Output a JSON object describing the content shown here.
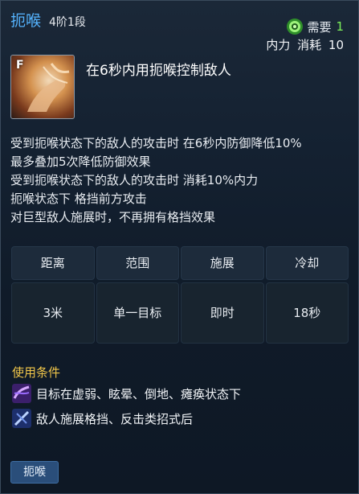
{
  "header": {
    "skill_name": "扼喉",
    "skill_tier": "4阶1段",
    "requirement_label": "需要",
    "requirement_value": "1",
    "cost_resource": "内力",
    "cost_label": "消耗",
    "cost_value": "10"
  },
  "skill": {
    "key": "F",
    "description": "在6秒内用扼喉控制敌人"
  },
  "effects": [
    "受到扼喉状态下的敌人的攻击时 在6秒内防御降低10%",
    "最多叠加5次降低防御效果",
    "受到扼喉状态下的敌人的攻击时 消耗10%内力",
    "扼喉状态下 格挡前方攻击",
    "对巨型敌人施展时，不再拥有格挡效果"
  ],
  "stats": {
    "headers": [
      "距离",
      "范围",
      "施展",
      "冷却"
    ],
    "values": [
      "3米",
      "单一目标",
      "即时",
      "18秒"
    ]
  },
  "conditions": {
    "title": "使用条件",
    "items": [
      {
        "icon": "weakness-stun-icon",
        "text": "目标在虚弱、眩晕、倒地、瘫痪状态下"
      },
      {
        "icon": "block-counter-icon",
        "text": "敌人施展格挡、反击类招式后"
      }
    ]
  },
  "footer": {
    "tag": "扼喉"
  },
  "colors": {
    "skill_name": "#55b4ff",
    "requirement_value": "#7cf05a",
    "conditions_title": "#f0c64a"
  }
}
